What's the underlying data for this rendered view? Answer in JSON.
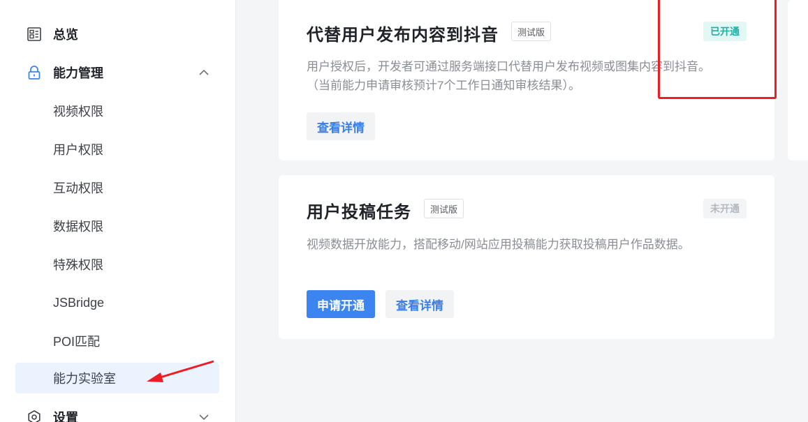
{
  "sidebar": {
    "overview": {
      "label": "总览",
      "icon": "dashboard-icon"
    },
    "capability": {
      "label": "能力管理",
      "icon": "lock-icon",
      "chevron": "chevron-up-icon"
    },
    "sub_items": [
      {
        "label": "视频权限"
      },
      {
        "label": "用户权限"
      },
      {
        "label": "互动权限"
      },
      {
        "label": "数据权限"
      },
      {
        "label": "特殊权限"
      },
      {
        "label": "JSBridge"
      },
      {
        "label": "POI匹配"
      },
      {
        "label": "能力实验室",
        "active": true
      }
    ],
    "settings": {
      "label": "设置",
      "icon": "gear-icon",
      "chevron": "chevron-down-icon"
    }
  },
  "cards": [
    {
      "title": "代替用户发布内容到抖音",
      "tag": "测试版",
      "status": "已开通",
      "desc_line1": "用户授权后，开发者可通过服务端接口代替用户发布视频或图集内容到抖音。",
      "desc_line2": "（当前能力申请审核预计7个工作日通知审核结果）。",
      "details_label": "查看详情"
    },
    {
      "title": "用户投稿任务",
      "tag": "测试版",
      "status": "未开通",
      "desc_line1": "视频数据开放能力，搭配移动/网站应用投稿能力获取投稿用户作品数据。",
      "apply_label": "申请开通",
      "details_label": "查看详情"
    }
  ],
  "colors": {
    "accent": "#3c84f0",
    "active_bg": "#ebf3ff",
    "status_on": "#1cb0a6",
    "annotation_red": "#ee1c24"
  }
}
